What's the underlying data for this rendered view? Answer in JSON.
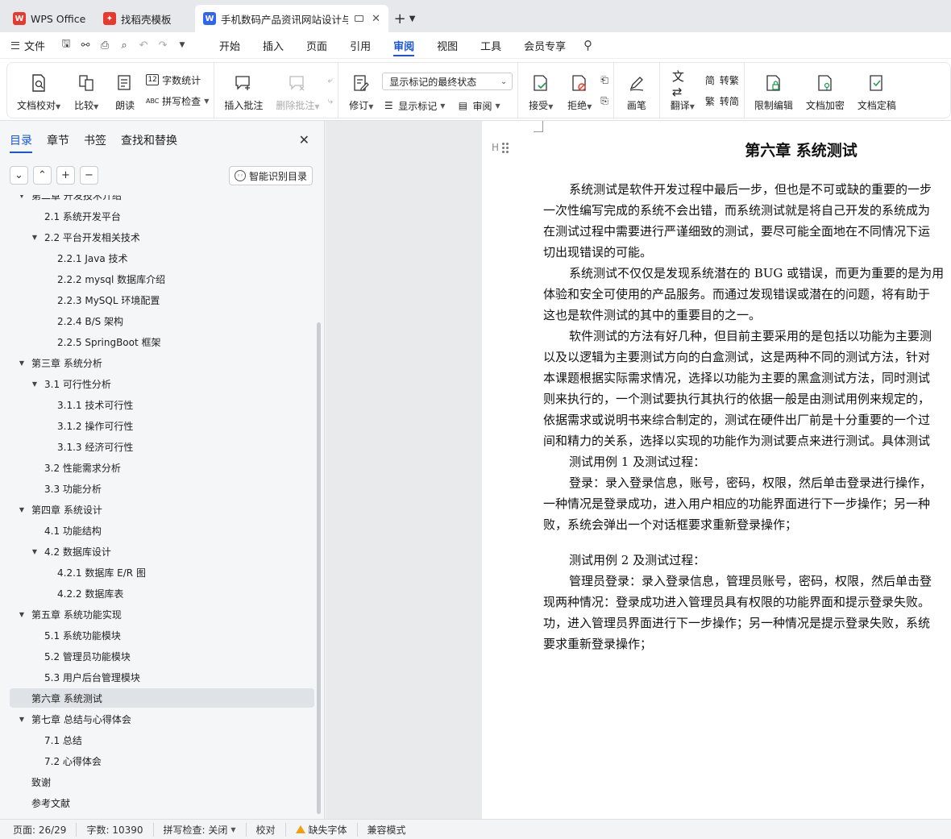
{
  "tabs": [
    {
      "label": "WPS Office",
      "logo": "W",
      "logo_color": "#e8392f"
    },
    {
      "label": "找稻壳模板",
      "logo": "✦",
      "logo_color": "#e8392f"
    },
    {
      "label": "手机数码产品资讯网站设计与实",
      "logo": "W",
      "logo_color": "#2f64f5"
    }
  ],
  "menubar": {
    "file_label": "文件",
    "items": [
      "开始",
      "插入",
      "页面",
      "引用",
      "审阅",
      "视图",
      "工具",
      "会员专享"
    ],
    "active": "审阅"
  },
  "ribbon": {
    "doc_check": "文档校对",
    "compare": "比较",
    "read_aloud": "朗读",
    "word_count": "字数统计",
    "spell_check": "拼写检查",
    "insert_comment": "插入批注",
    "delete_comment": "删除批注",
    "track_changes": "修订",
    "markup_state": "显示标记的最终状态",
    "show_markup": "显示标记",
    "review": "审阅",
    "accept": "接受",
    "reject": "拒绝",
    "ink": "画笔",
    "translate": "翻译",
    "to_traditional": "转繁",
    "to_simplified": "转简",
    "restrict_editing": "限制编辑",
    "encrypt": "文档加密",
    "finalize": "文档定稿"
  },
  "nav": {
    "tabs": [
      "目录",
      "章节",
      "书签",
      "查找和替换"
    ],
    "smart_toc": "智能识别目录",
    "toc": [
      {
        "label": "第二章  开发技术介绍",
        "level": 0,
        "expanded": true,
        "partial": true
      },
      {
        "label": "2.1  系统开发平台",
        "level": 1
      },
      {
        "label": "2.2  平台开发相关技术",
        "level": 1,
        "expanded": true
      },
      {
        "label": "2.2.1 Java 技术",
        "level": 2
      },
      {
        "label": "2.2.2 mysql 数据库介绍",
        "level": 2
      },
      {
        "label": "2.2.3 MySQL 环境配置",
        "level": 2
      },
      {
        "label": "2.2.4 B/S 架构",
        "level": 2
      },
      {
        "label": "2.2.5 SpringBoot 框架",
        "level": 2
      },
      {
        "label": "第三章  系统分析",
        "level": 0,
        "expanded": true
      },
      {
        "label": "3.1  可行性分析",
        "level": 1,
        "expanded": true
      },
      {
        "label": "3.1.1 技术可行性",
        "level": 2
      },
      {
        "label": "3.1.2 操作可行性",
        "level": 2
      },
      {
        "label": "3.1.3   经济可行性",
        "level": 2
      },
      {
        "label": "3.2 性能需求分析",
        "level": 1
      },
      {
        "label": "3.3 功能分析",
        "level": 1
      },
      {
        "label": "第四章  系统设计",
        "level": 0,
        "expanded": true
      },
      {
        "label": "4.1 功能结构",
        "level": 1
      },
      {
        "label": "4.2  数据库设计",
        "level": 1,
        "expanded": true
      },
      {
        "label": "4.2.1   数据库 E/R 图",
        "level": 2
      },
      {
        "label": "4.2.2   数据库表",
        "level": 2
      },
      {
        "label": "第五章  系统功能实现",
        "level": 0,
        "expanded": true
      },
      {
        "label": "5.1 系统功能模块",
        "level": 1
      },
      {
        "label": "5.2  管理员功能模块",
        "level": 1
      },
      {
        "label": "5.3  用户后台管理模块",
        "level": 1
      },
      {
        "label": "第六章  系统测试",
        "level": 0,
        "selected": true
      },
      {
        "label": "第七章  总结与心得体会",
        "level": 0,
        "expanded": true
      },
      {
        "label": "7.1  总结",
        "level": 1
      },
      {
        "label": "7.2  心得体会",
        "level": 1
      },
      {
        "label": "致谢",
        "level": 0
      },
      {
        "label": "参考文献",
        "level": 0
      }
    ]
  },
  "document": {
    "heading_marker": "H",
    "title": "第六章  系统测试",
    "lines": [
      {
        "text": "系统测试是软件开发过程中最后一步，但也是不可或缺的重要的一步",
        "indent": true
      },
      {
        "text": "一次性编写完成的系统不会出错，而系统测试就是将自己开发的系统成为",
        "indent": false
      },
      {
        "text": "在测试过程中需要进行严谨细致的测试，要尽可能全面地在不同情况下运",
        "indent": false
      },
      {
        "text": "切出现错误的可能。",
        "indent": false
      },
      {
        "text": "系统测试不仅仅是发现系统潜在的 BUG 或错误，而更为重要的是为用",
        "indent": true
      },
      {
        "text": "体验和安全可使用的产品服务。而通过发现错误或潜在的问题，将有助于",
        "indent": false
      },
      {
        "text": "这也是软件测试的其中的重要目的之一。",
        "indent": false
      },
      {
        "text": "软件测试的方法有好几种，但目前主要采用的是包括以功能为主要测",
        "indent": true
      },
      {
        "text": "以及以逻辑为主要测试方向的白盒测试，这是两种不同的测试方法，针对",
        "indent": false
      },
      {
        "text": "本课题根据实际需求情况，选择以功能为主要的黑盒测试方法，同时测试",
        "indent": false
      },
      {
        "text": "则来执行的，一个测试要执行其执行的依据一般是由测试用例来规定的，",
        "indent": false
      },
      {
        "text": "依据需求或说明书来综合制定的，测试在硬件出厂前是十分重要的一个过",
        "indent": false
      },
      {
        "text": "间和精力的关系，选择以实现的功能作为测试要点来进行测试。具体测试",
        "indent": false
      },
      {
        "text": "测试用例 1 及测试过程：",
        "indent": true
      },
      {
        "text": "登录：录入登录信息，账号，密码，权限，然后单击登录进行操作，",
        "indent": true
      },
      {
        "text": "一种情况是登录成功，进入用户相应的功能界面进行下一步操作；另一种",
        "indent": false
      },
      {
        "text": "败，系统会弹出一个对话框要求重新登录操作；",
        "indent": false
      },
      {
        "gap": true
      },
      {
        "text": "测试用例 2 及测试过程：",
        "indent": true
      },
      {
        "text": "管理员登录：录入登录信息，管理员账号，密码，权限，然后单击登",
        "indent": true
      },
      {
        "text": "现两种情况：登录成功进入管理员具有权限的功能界面和提示登录失败。",
        "indent": false
      },
      {
        "text": "功，进入管理员界面进行下一步操作；另一种情况是提示登录失败，系统",
        "indent": false
      },
      {
        "text": "要求重新登录操作；",
        "indent": false
      }
    ]
  },
  "status": {
    "page": "页面: 26/29",
    "words": "字数: 10390",
    "spell": "拼写检查: 关闭",
    "proof": "校对",
    "missing_font": "缺失字体",
    "compat": "兼容模式"
  },
  "colors": {
    "accent": "#1a56db",
    "wps_red": "#e8392f",
    "writer_blue": "#2f64f5",
    "warning": "#f59e0b"
  }
}
